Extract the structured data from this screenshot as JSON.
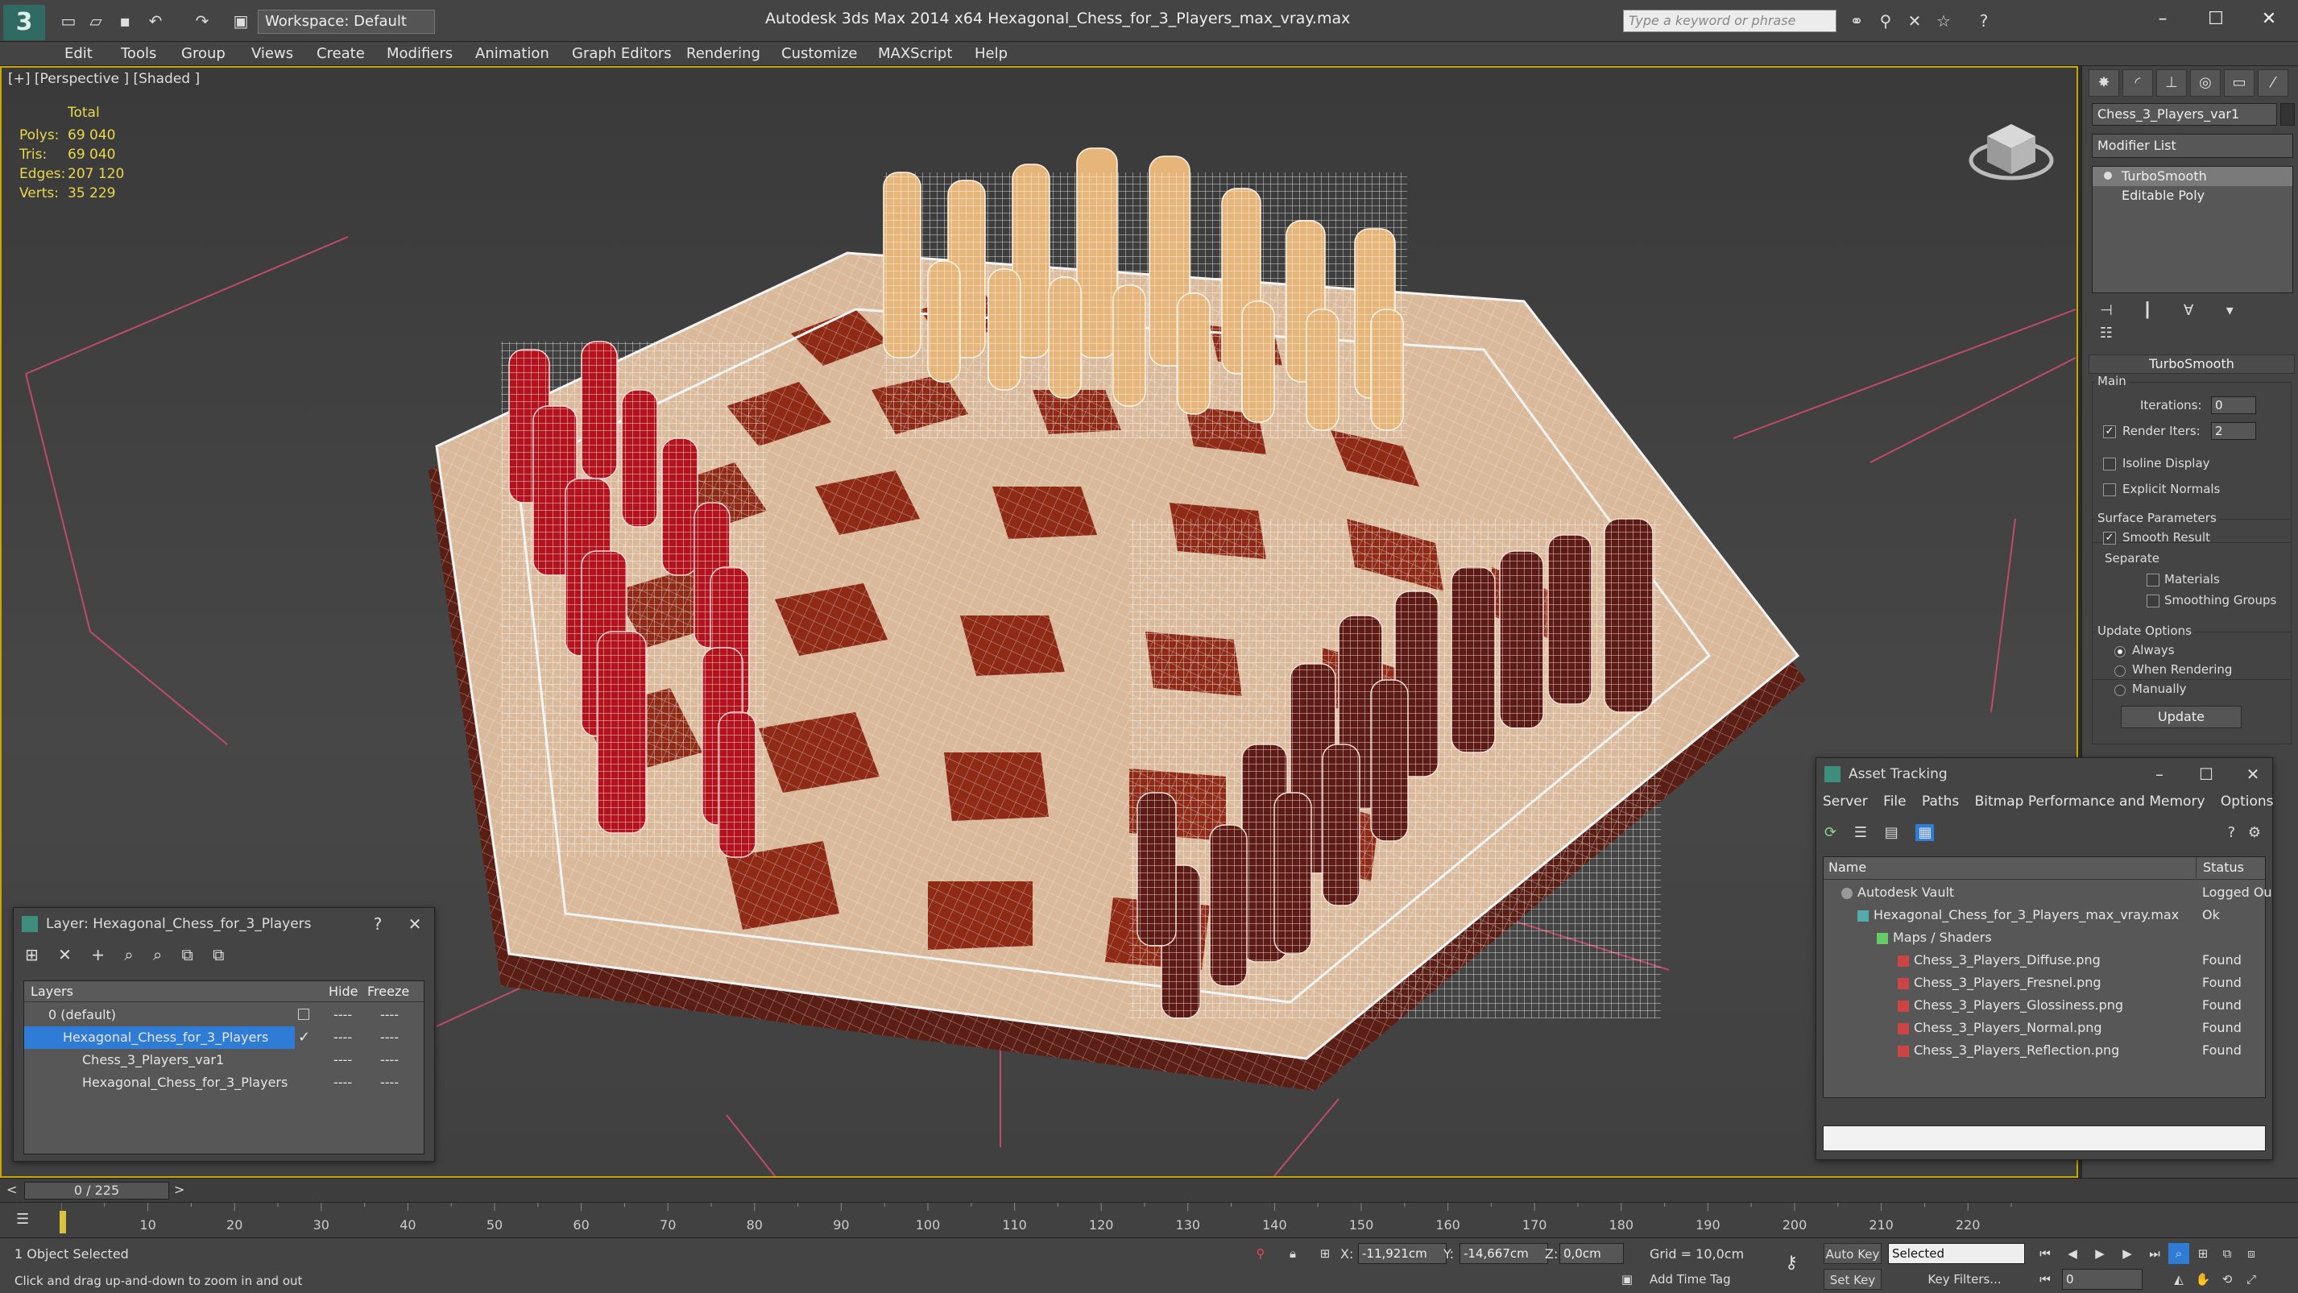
{
  "titlebar": {
    "workspace": "Workspace: Default",
    "app_title": "Autodesk 3ds Max  2014 x64      Hexagonal_Chess_for_3_Players_max_vray.max",
    "search_placeholder": "Type a keyword or phrase"
  },
  "menu": [
    "Edit",
    "Tools",
    "Group",
    "Views",
    "Create",
    "Modifiers",
    "Animation",
    "Graph Editors",
    "Rendering",
    "Customize",
    "MAXScript",
    "Help"
  ],
  "viewport": {
    "label": "[+] [Perspective ] [Shaded ]",
    "stats_total": "Total",
    "stats": [
      {
        "label": "Polys:",
        "value": "69 040"
      },
      {
        "label": "Tris:",
        "value": "69 040"
      },
      {
        "label": "Edges:",
        "value": "207 120"
      },
      {
        "label": "Verts:",
        "value": "35 229"
      }
    ]
  },
  "command_panel": {
    "object_name": "Chess_3_Players_var1",
    "modifier_list": "Modifier List",
    "stack": [
      "TurboSmooth",
      "Editable Poly"
    ],
    "rollout_title": "TurboSmooth",
    "main_group": "Main",
    "iterations_label": "Iterations:",
    "iterations_value": "0",
    "render_iters_label": "Render Iters:",
    "render_iters_value": "2",
    "isoline_label": "Isoline Display",
    "explicit_normals_label": "Explicit Normals",
    "surface_group": "Surface Parameters",
    "smooth_result_label": "Smooth Result",
    "separate_label": "Separate",
    "materials_label": "Materials",
    "smoothing_groups_label": "Smoothing Groups",
    "update_group": "Update Options",
    "always_label": "Always",
    "when_rendering_label": "When Rendering",
    "manually_label": "Manually",
    "update_button": "Update"
  },
  "layer_window": {
    "title": "Layer: Hexagonal_Chess_for_3_Players",
    "help": "?",
    "col_layers": "Layers",
    "col_hide": "Hide",
    "col_freeze": "Freeze",
    "rows": [
      {
        "name": "0 (default)",
        "hide": "----",
        "freeze": "----"
      },
      {
        "name": "Hexagonal_Chess_for_3_Players",
        "hide": "----",
        "freeze": "----"
      },
      {
        "name": "Chess_3_Players_var1",
        "hide": "----",
        "freeze": "----"
      },
      {
        "name": "Hexagonal_Chess_for_3_Players",
        "hide": "----",
        "freeze": "----"
      }
    ]
  },
  "asset_window": {
    "title": "Asset Tracking",
    "menu": [
      "Server",
      "File",
      "Paths",
      "Bitmap Performance and Memory",
      "Options"
    ],
    "col_name": "Name",
    "col_status": "Status",
    "rows": [
      {
        "name": "Autodesk Vault",
        "status": "Logged Ou"
      },
      {
        "name": "Hexagonal_Chess_for_3_Players_max_vray.max",
        "status": "Ok"
      },
      {
        "name": "Maps / Shaders",
        "status": ""
      },
      {
        "name": "Chess_3_Players_Diffuse.png",
        "status": "Found"
      },
      {
        "name": "Chess_3_Players_Fresnel.png",
        "status": "Found"
      },
      {
        "name": "Chess_3_Players_Glossiness.png",
        "status": "Found"
      },
      {
        "name": "Chess_3_Players_Normal.png",
        "status": "Found"
      },
      {
        "name": "Chess_3_Players_Reflection.png",
        "status": "Found"
      }
    ]
  },
  "timeline": {
    "frame_display": "0 / 225",
    "ticks": [
      "10",
      "20",
      "30",
      "40",
      "50",
      "60",
      "70",
      "80",
      "90",
      "100",
      "110",
      "120",
      "130",
      "140",
      "150",
      "160",
      "170",
      "180",
      "190",
      "200",
      "210",
      "220"
    ]
  },
  "status": {
    "selection": "1 Object Selected",
    "prompt": "Click and drag up-and-down to zoom in and out",
    "x_label": "X:",
    "x_value": "-11,921cm",
    "y_label": "Y:",
    "y_value": "-14,667cm",
    "z_label": "Z:",
    "z_value": "0,0cm",
    "grid": "Grid = 10,0cm",
    "add_time_tag": "Add Time Tag",
    "auto_key": "Auto Key",
    "selected": "Selected",
    "set_key": "Set Key",
    "key_filters": "Key Filters...",
    "frame": "0"
  },
  "colors": {
    "accent_blue": "#2f7cd6",
    "viewport_border": "#c8a800",
    "stats_yellow": "#e8d84a"
  }
}
